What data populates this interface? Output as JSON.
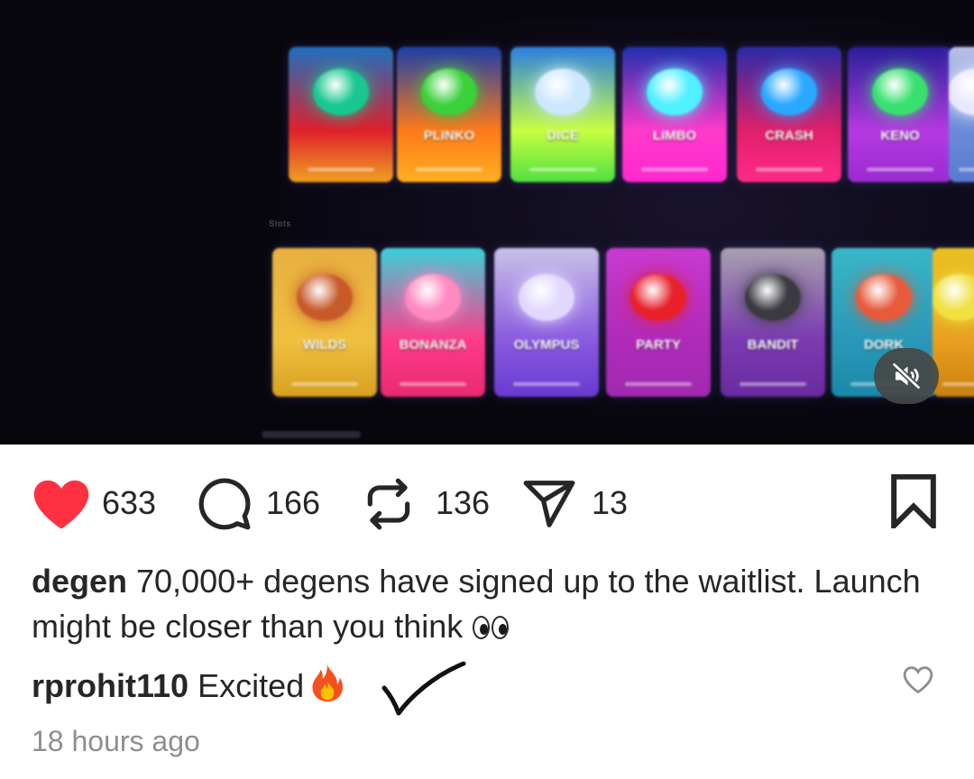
{
  "media": {
    "top_row": [
      {
        "title": "",
        "colors": [
          "#1f6fbf",
          "#e0202a",
          "#f0a020"
        ],
        "blob": "#18c890"
      },
      {
        "title": "PLINKO",
        "colors": [
          "#1c3fa8",
          "#ff7a1a",
          "#ffb020"
        ],
        "blob": "#3ad13a"
      },
      {
        "title": "DICE",
        "colors": [
          "#2a7fe0",
          "#c8ff40",
          "#50e040"
        ],
        "blob": "#cde7ff"
      },
      {
        "title": "LIMBO",
        "colors": [
          "#1e2fb0",
          "#ff3acb",
          "#ff28d0"
        ],
        "blob": "#4ff0ff"
      },
      {
        "title": "CRASH",
        "colors": [
          "#2a2aa8",
          "#e0206a",
          "#ff2a8a"
        ],
        "blob": "#2aa8ff"
      },
      {
        "title": "KENO",
        "colors": [
          "#2a1e9a",
          "#b43ae0",
          "#9a2ad0"
        ],
        "blob": "#38e070"
      },
      {
        "title": "",
        "colors": [
          "#b8c0e8",
          "#6a8ad8",
          "#5a7ad0"
        ],
        "blob": "#e8e8ff"
      }
    ],
    "row_label": "Slots",
    "bottom_row": [
      {
        "title": "WILDS",
        "colors": [
          "#e8b040",
          "#f0c040",
          "#d8a020"
        ],
        "blob": "#c85a2a"
      },
      {
        "title": "BONANZA",
        "colors": [
          "#3ad0d8",
          "#ff3a8a",
          "#e82a70"
        ],
        "blob": "#ff8ac0"
      },
      {
        "title": "OLYMPUS",
        "colors": [
          "#c8c0e8",
          "#8a5ae0",
          "#6a3ad0"
        ],
        "blob": "#e0d8ff"
      },
      {
        "title": "PARTY",
        "colors": [
          "#c83ad0",
          "#b02ab8",
          "#a02ab0"
        ],
        "blob": "#e8202a"
      },
      {
        "title": "BANDIT",
        "colors": [
          "#a8a0b0",
          "#7a3ab0",
          "#6a2aa0"
        ],
        "blob": "#3a3a40"
      },
      {
        "title": "DORK",
        "colors": [
          "#38b8c8",
          "#2a98b8",
          "#1a88a8"
        ],
        "blob": "#e85a3a"
      },
      {
        "title": "",
        "colors": [
          "#e8c020",
          "#e8a020",
          "#c88010"
        ],
        "blob": "#f0e040"
      }
    ],
    "mute_icon": "speaker-muted-icon"
  },
  "actions": {
    "like_count": "633",
    "comment_count": "166",
    "repost_count": "136",
    "share_count": "13",
    "like_color": "#ff3040",
    "icons": [
      "heart-icon",
      "comment-icon",
      "repost-icon",
      "share-icon",
      "bookmark-icon"
    ]
  },
  "caption": {
    "username": "degen",
    "text": " 70,000+ degens have signed up to the waitlist. Launch might be closer than you think "
  },
  "comment": {
    "username": "rprohit110",
    "text": " Excited"
  },
  "timestamp": "18 hours ago"
}
